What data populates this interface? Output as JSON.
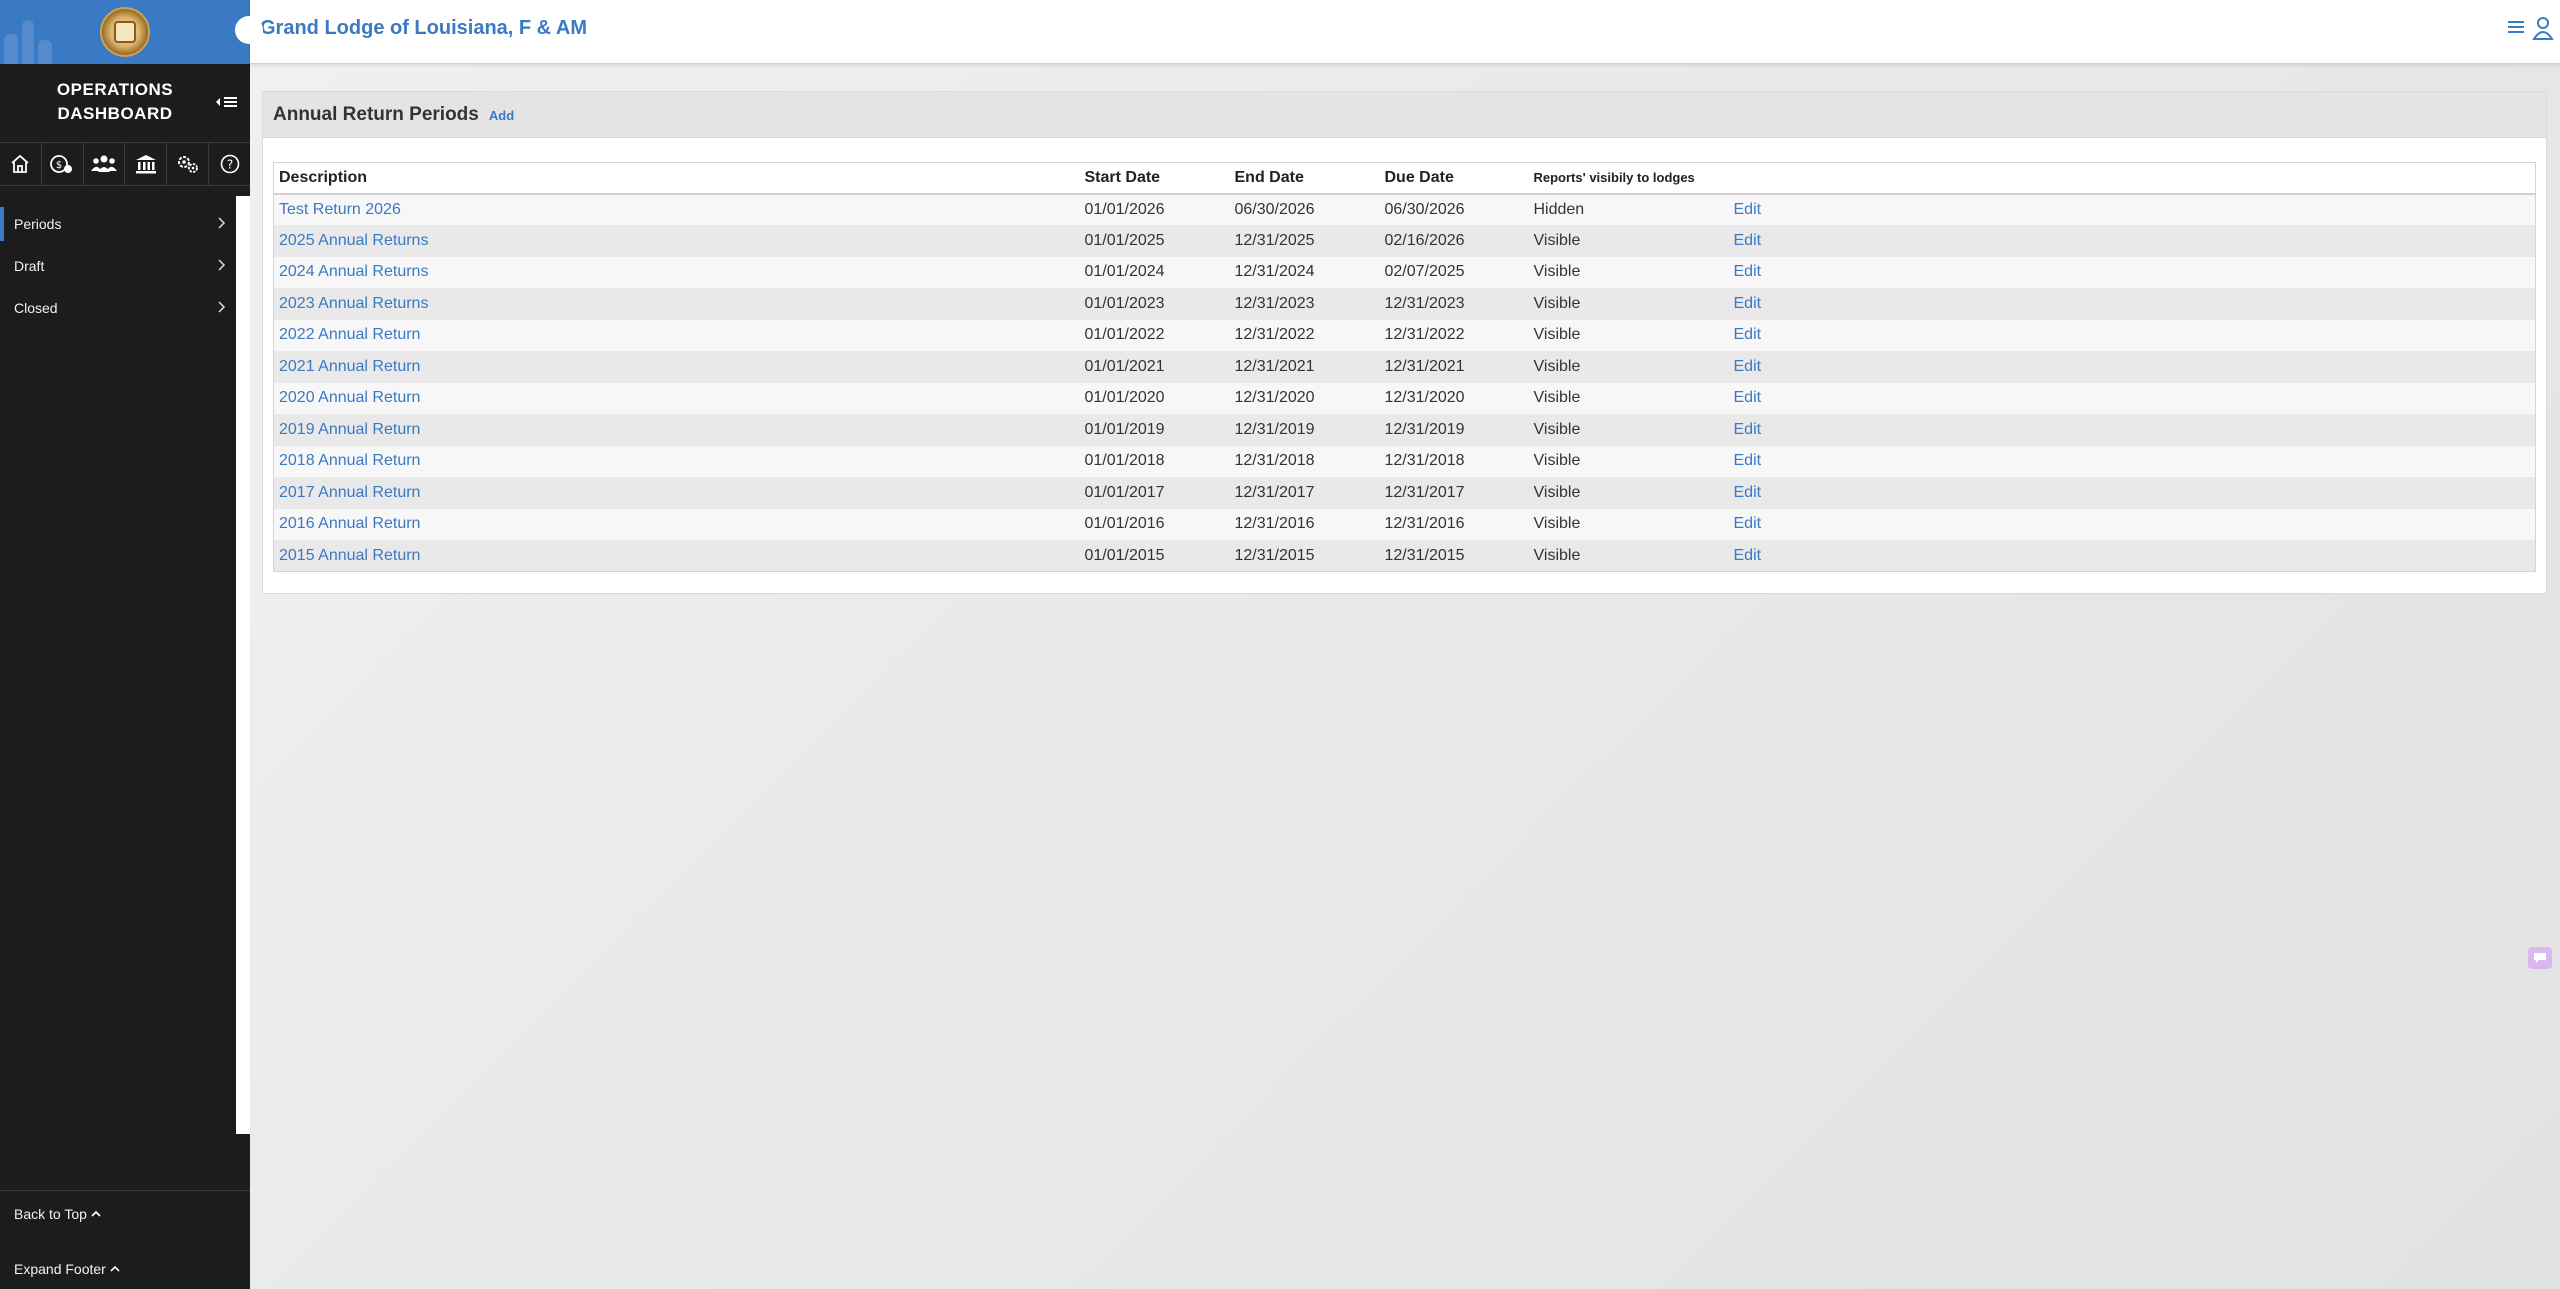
{
  "sidebar": {
    "dashboard_title_line1": "OPERATIONS",
    "dashboard_title_line2": "DASHBOARD",
    "nav_items": [
      {
        "label": "Periods",
        "active": true
      },
      {
        "label": "Draft",
        "active": false
      },
      {
        "label": "Closed",
        "active": false
      }
    ],
    "icon_bar": [
      "home-icon",
      "lodge-settings-icon",
      "members-icon",
      "institution-icon",
      "settings-icon",
      "help-icon"
    ],
    "back_to_top": "Back to Top",
    "expand_footer": "Expand Footer",
    "accent_color": "#3a79c4"
  },
  "header": {
    "title": "Grand Lodge of Louisiana, F & AM"
  },
  "panel": {
    "title": "Annual Return Periods",
    "add_label": "Add",
    "columns": {
      "description": "Description",
      "start_date": "Start Date",
      "end_date": "End Date",
      "due_date": "Due Date",
      "visibility": "Reports' visibily to lodges"
    },
    "rows": [
      {
        "description": "Test Return 2026",
        "start": "01/01/2026",
        "end": "06/30/2026",
        "due": "06/30/2026",
        "visibility": "Hidden",
        "action": "Edit"
      },
      {
        "description": "2025 Annual Returns",
        "start": "01/01/2025",
        "end": "12/31/2025",
        "due": "02/16/2026",
        "visibility": "Visible",
        "action": "Edit"
      },
      {
        "description": "2024 Annual Returns",
        "start": "01/01/2024",
        "end": "12/31/2024",
        "due": "02/07/2025",
        "visibility": "Visible",
        "action": "Edit"
      },
      {
        "description": "2023 Annual Returns",
        "start": "01/01/2023",
        "end": "12/31/2023",
        "due": "12/31/2023",
        "visibility": "Visible",
        "action": "Edit"
      },
      {
        "description": "2022 Annual Return",
        "start": "01/01/2022",
        "end": "12/31/2022",
        "due": "12/31/2022",
        "visibility": "Visible",
        "action": "Edit"
      },
      {
        "description": "2021 Annual Return",
        "start": "01/01/2021",
        "end": "12/31/2021",
        "due": "12/31/2021",
        "visibility": "Visible",
        "action": "Edit"
      },
      {
        "description": "2020 Annual Return",
        "start": "01/01/2020",
        "end": "12/31/2020",
        "due": "12/31/2020",
        "visibility": "Visible",
        "action": "Edit"
      },
      {
        "description": "2019 Annual Return",
        "start": "01/01/2019",
        "end": "12/31/2019",
        "due": "12/31/2019",
        "visibility": "Visible",
        "action": "Edit"
      },
      {
        "description": "2018 Annual Return",
        "start": "01/01/2018",
        "end": "12/31/2018",
        "due": "12/31/2018",
        "visibility": "Visible",
        "action": "Edit"
      },
      {
        "description": "2017 Annual Return",
        "start": "01/01/2017",
        "end": "12/31/2017",
        "due": "12/31/2017",
        "visibility": "Visible",
        "action": "Edit"
      },
      {
        "description": "2016 Annual Return",
        "start": "01/01/2016",
        "end": "12/31/2016",
        "due": "12/31/2016",
        "visibility": "Visible",
        "action": "Edit"
      },
      {
        "description": "2015 Annual Return",
        "start": "01/01/2015",
        "end": "12/31/2015",
        "due": "12/31/2015",
        "visibility": "Visible",
        "action": "Edit"
      }
    ]
  }
}
